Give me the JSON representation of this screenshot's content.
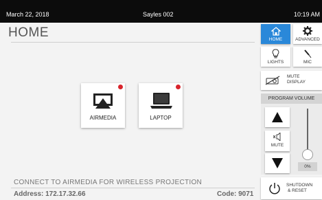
{
  "status_bar": {
    "date": "March 22, 2018",
    "room": "Sayles 002",
    "time": "10:19 AM"
  },
  "page": {
    "title": "HOME"
  },
  "sources": [
    {
      "label": "AIRMEDIA",
      "icon": "airplay-icon",
      "active_indicator_color": "#d8242c"
    },
    {
      "label": "LAPTOP",
      "icon": "laptop-icon",
      "active_indicator_color": "#d8242c"
    }
  ],
  "footer": {
    "hint": "CONNECT TO AIRMEDIA FOR WIRELESS PROJECTION",
    "address": "Address:  172.17.32.66",
    "code": "Code: 9071"
  },
  "nav": {
    "home": "HOME",
    "advanced": "ADVANCED",
    "lights": "LIGHTS",
    "mic": "MIC",
    "mute_display_1": "MUTE",
    "mute_display_2": "DISPLAY"
  },
  "volume": {
    "header": "PROGRAM VOLUME",
    "mute_label": "MUTE",
    "level_text": "0%",
    "level": 0
  },
  "shutdown": {
    "line1": "SHUTDOWN",
    "line2": "& RESET"
  },
  "colors": {
    "accent": "#2a88d9",
    "status_dot": "#d8242c",
    "topbar": "#0c0c0c"
  }
}
